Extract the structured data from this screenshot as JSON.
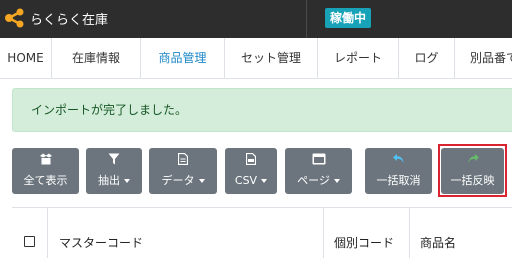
{
  "header": {
    "app_name": "らくらく在庫",
    "status_badge": "稼働中",
    "logo_icon": "share-nodes-icon",
    "badge_color": "#17a2b8"
  },
  "nav": {
    "items": [
      {
        "label": "HOME"
      },
      {
        "label": "在庫情報"
      },
      {
        "label": "商品管理"
      },
      {
        "label": "セット管理"
      },
      {
        "label": "レポート"
      },
      {
        "label": "ログ"
      },
      {
        "label": "別品番での"
      }
    ],
    "active_index": 2,
    "active_color": "#1e88c7"
  },
  "alert": {
    "message": "インポートが完了しました。"
  },
  "toolbar": {
    "buttons": [
      {
        "label": "全て表示",
        "icon": "box-open-icon"
      },
      {
        "label": "抽出",
        "icon": "filter-icon",
        "dropdown": true
      },
      {
        "label": "データ",
        "icon": "file-icon",
        "dropdown": true
      },
      {
        "label": "CSV",
        "icon": "csv-file-icon",
        "dropdown": true
      },
      {
        "label": "ページ",
        "icon": "window-icon",
        "dropdown": true
      },
      {
        "label": "一括取消",
        "icon": "undo-arrow-icon"
      },
      {
        "label": "一括反映",
        "icon": "redo-arrow-icon"
      }
    ],
    "undo_icon_color": "#4fc3f7",
    "redo_icon_color": "#66bb6a",
    "highlight_color": "#d9232e"
  },
  "table": {
    "headers": [
      "マスターコード",
      "個別コード",
      "商品名"
    ]
  }
}
